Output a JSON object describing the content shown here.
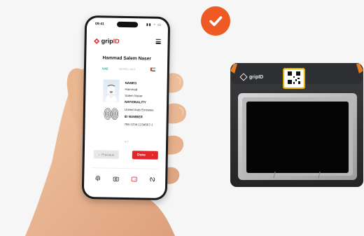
{
  "phone": {
    "status": {
      "time": "09:41"
    },
    "brand": {
      "prefix": "grip",
      "accent": "ID"
    },
    "person_name": "Hammad Salem Naser",
    "id_tabs": {
      "country": "UAE",
      "type": "Identity card"
    },
    "fields": [
      {
        "label": "NAMES",
        "values": [
          "Hammad",
          "Salem Naser"
        ]
      },
      {
        "label": "NATIONALITY",
        "values": [
          "United Arab Emirates"
        ]
      },
      {
        "label": "ID NUMBER",
        "values": [
          "784-1234-1234567-1"
        ]
      }
    ],
    "mrz_hint": "ET",
    "buttons": {
      "previous": "Previous",
      "done": "Done"
    },
    "tabs": [
      "fingerprint-icon",
      "camera-icon",
      "wallet-icon",
      "nfc-icon"
    ]
  },
  "device": {
    "brand": "gripID"
  },
  "colors": {
    "accent": "#e3262a",
    "check": "#ee5a24",
    "country_tab": "#2a9d8f"
  }
}
